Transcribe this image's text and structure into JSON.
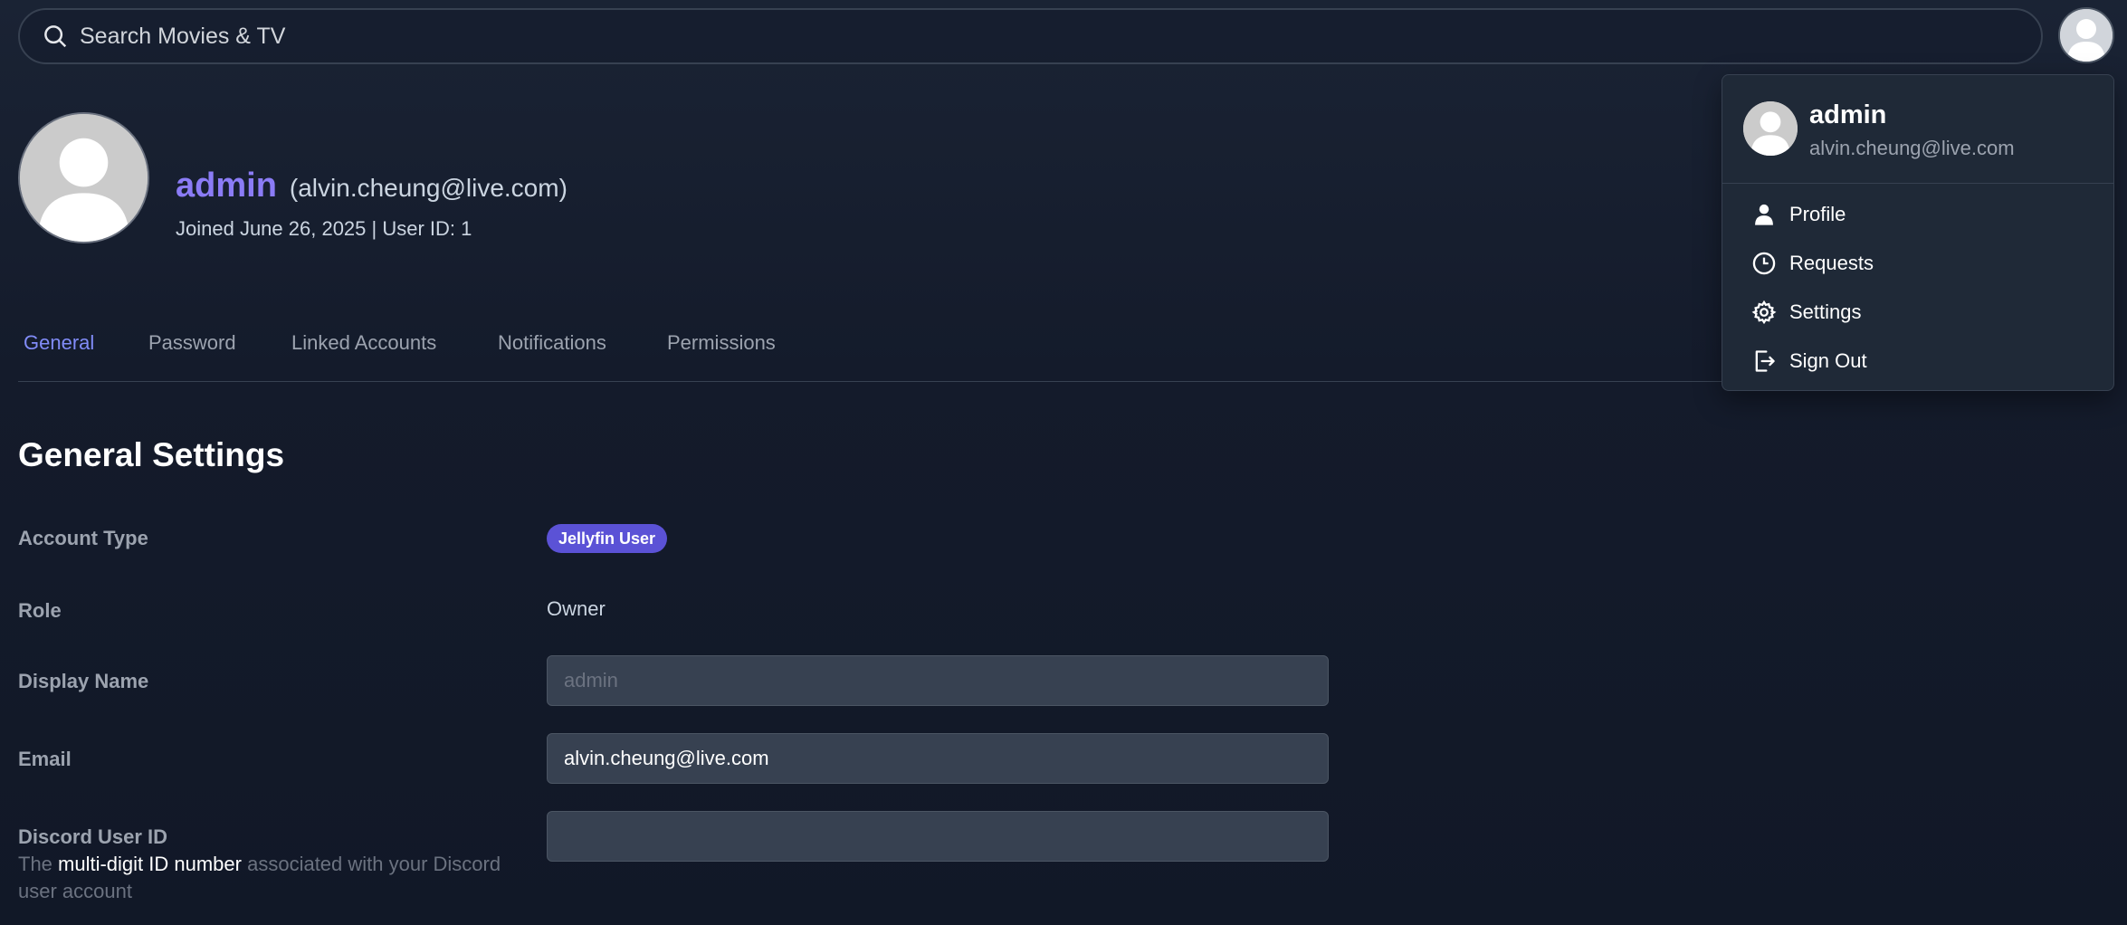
{
  "search": {
    "placeholder": "Search Movies & TV"
  },
  "profile": {
    "username": "admin",
    "email": "(alvin.cheung@live.com)",
    "joined": "Joined June 26, 2025 | User ID: 1"
  },
  "tabs": [
    {
      "label": "General",
      "active": true
    },
    {
      "label": "Password"
    },
    {
      "label": "Linked Accounts"
    },
    {
      "label": "Notifications"
    },
    {
      "label": "Permissions"
    }
  ],
  "settings": {
    "title": "General Settings",
    "account_type_label": "Account Type",
    "account_type_value": "Jellyfin User",
    "role_label": "Role",
    "role_value": "Owner",
    "display_name_label": "Display Name",
    "display_name_placeholder": "admin",
    "email_label": "Email",
    "email_value": "alvin.cheung@live.com",
    "discord_label": "Discord User ID",
    "discord_desc_pre": "The ",
    "discord_desc_bold": "multi-digit ID number",
    "discord_desc_post": " associated with your Discord user account"
  },
  "menu": {
    "name": "admin",
    "email": "alvin.cheung@live.com",
    "items": [
      {
        "label": "Profile",
        "icon": "user-icon"
      },
      {
        "label": "Requests",
        "icon": "clock-icon"
      },
      {
        "label": "Settings",
        "icon": "gear-icon"
      },
      {
        "label": "Sign Out",
        "icon": "sign-out-icon"
      }
    ]
  },
  "colors": {
    "accent": "#818cf8",
    "username": "#8b7cf6",
    "badge": "#5b52d6",
    "background": "#111827"
  }
}
